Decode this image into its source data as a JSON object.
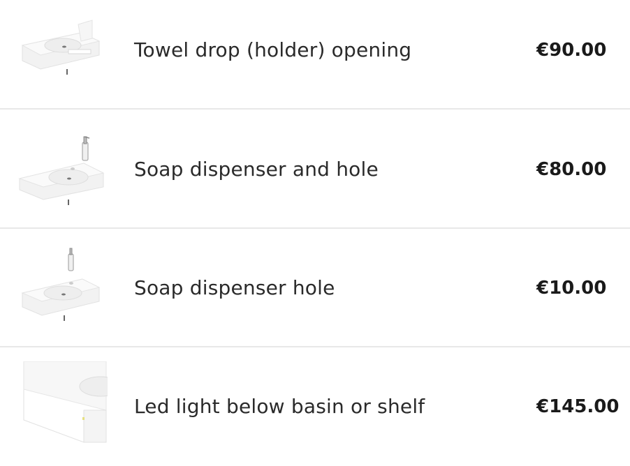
{
  "options": [
    {
      "name": "Towel drop (holder) opening",
      "price": "€90.00",
      "icon": "basin-towel-holder-icon"
    },
    {
      "name": "Soap dispenser and hole",
      "price": "€80.00",
      "icon": "basin-soap-dispenser-icon"
    },
    {
      "name": "Soap dispenser hole",
      "price": "€10.00",
      "icon": "basin-soap-hole-icon"
    },
    {
      "name": "Led light below basin or shelf",
      "price": "€145.00",
      "icon": "basin-led-light-icon"
    }
  ],
  "colors": {
    "divider": "#e8e8e8",
    "text": "#2a2a2a",
    "price": "#1a1a1a"
  }
}
